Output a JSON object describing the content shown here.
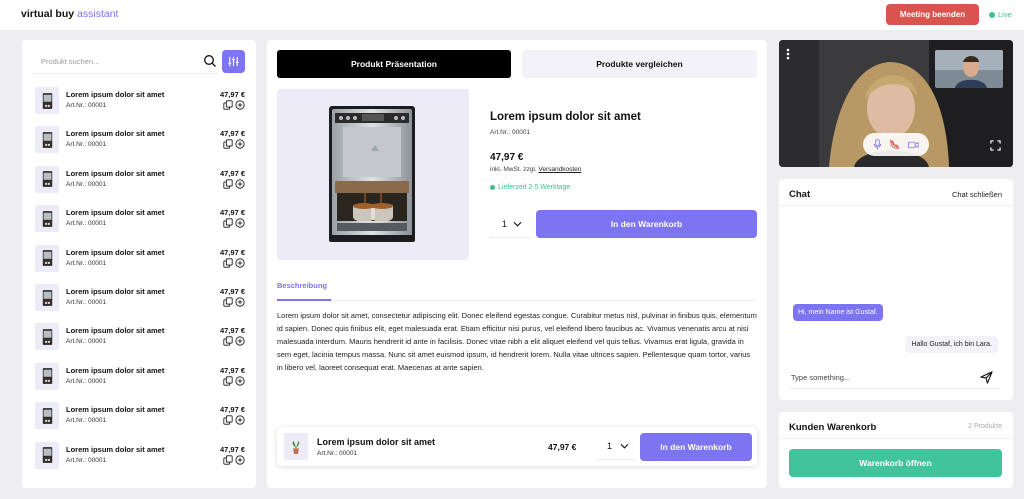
{
  "header": {
    "brand_main": "virtual buy",
    "brand_sub": "assistant",
    "end_meeting_label": "Meeting beenden",
    "live_label": "Live"
  },
  "product_list": {
    "search_placeholder": "Produkt suchen...",
    "items": [
      {
        "title": "Lorem ipsum dolor sit amet",
        "art": "Art.Nr.: 00001",
        "price": "47,97 €"
      },
      {
        "title": "Lorem ipsum dolor sit amet",
        "art": "Art.Nr.: 00001",
        "price": "47,97 €"
      },
      {
        "title": "Lorem ipsum dolor sit amet",
        "art": "Art.Nr.: 00001",
        "price": "47,97 €"
      },
      {
        "title": "Lorem ipsum dolor sit amet",
        "art": "Art.Nr.: 00001",
        "price": "47,97 €"
      },
      {
        "title": "Lorem ipsum dolor sit amet",
        "art": "Art.Nr.: 00001",
        "price": "47,97 €"
      },
      {
        "title": "Lorem ipsum dolor sit amet",
        "art": "Art.Nr.: 00001",
        "price": "47,97 €"
      },
      {
        "title": "Lorem ipsum dolor sit amet",
        "art": "Art.Nr.: 00001",
        "price": "47,97 €"
      },
      {
        "title": "Lorem ipsum dolor sit amet",
        "art": "Art.Nr.: 00001",
        "price": "47,97 €"
      },
      {
        "title": "Lorem ipsum dolor sit amet",
        "art": "Art.Nr.: 00001",
        "price": "47,97 €"
      },
      {
        "title": "Lorem ipsum dolor sit amet",
        "art": "Art.Nr.: 00001",
        "price": "47,97 €"
      }
    ],
    "icons": [
      "copy-icon",
      "add-circle-icon"
    ]
  },
  "tabs": {
    "presentation": "Produkt Präsentation",
    "compare": "Produkte vergleichen"
  },
  "product": {
    "title": "Lorem ipsum dolor sit amet",
    "art": "Art.Nr.: 00001",
    "price": "47,97 €",
    "tax_prefix": "inkl. MwSt. zzgl.",
    "tax_link": "Versandkosten",
    "delivery": "Lieferzeit 2-5 Werktage",
    "quantity": "1",
    "add_to_cart": "In den Warenkorb",
    "description_tab": "Beschreibung",
    "description": "Lorem ipsum dolor sit amet, consectetur adipiscing elit. Donec eleifend egestas congue. Curabitur metus nisl, pulvinar in finibus quis, elementum id sapien. Donec quis finibus elit, eget malesuada erat. Etiam efficitur nisi purus, vel eleifend libero faucibus ac. Vivamus venenatis arcu at nisi malesuada interdum. Mauris hendrerit id ante in facilisis. Donec vitae nibh a elit aliquet eleifend vel quis tellus. Vivamus erat ligula, gravida in sem eget, lacinia tempus massa. Nunc sit amet euismod ipsum, id hendrerit lorem. Nulla vitae ultrices sapien. Pellentesque quam tortor, varius in libero vel, laoreet consequat erat. Maecenas at ante sapien."
  },
  "sticky_bar": {
    "title": "Lorem ipsum dolor sit amet",
    "art": "Art.Nr.: 00001",
    "price": "47,97 €",
    "quantity": "1",
    "add_to_cart": "In den Warenkorb"
  },
  "video": {
    "icons": [
      "more-vertical-icon",
      "microphone-icon",
      "hang-up-icon",
      "camera-icon",
      "fullscreen-icon"
    ]
  },
  "chat": {
    "title": "Chat",
    "close_label": "Chat schließen",
    "messages": [
      {
        "from": "customer",
        "text": "Hi, mein Name ist Gustaf."
      },
      {
        "from": "agent",
        "text": "Hallo Gustaf, ich bin Lara."
      }
    ],
    "input_placeholder": "Type something..."
  },
  "basket": {
    "title": "Kunden Warenkorb",
    "count": "2 Produkte",
    "open_label": "Warenkorb öffnen"
  },
  "colors": {
    "accent": "#7c74f0",
    "danger": "#d9534f",
    "success": "#41c49b",
    "live": "#3fbf8f"
  }
}
